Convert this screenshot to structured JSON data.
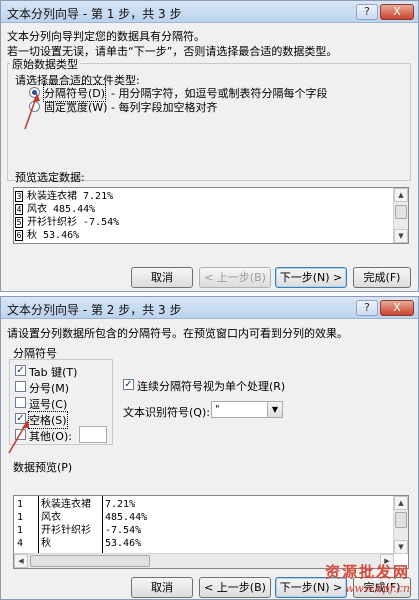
{
  "step1": {
    "title": "文本分列向导 - 第 1 步，共 3 步",
    "intro": "文本分列向导判定您的数据具有分隔符。",
    "instruction": "若一切设置无误，请单击“下一步”，否则请选择最合适的数据类型。",
    "group_label": "原始数据类型",
    "choose_label": "请选择最合适的文件类型:",
    "options": [
      {
        "label": "分隔符号(D)",
        "desc": "- 用分隔字符，如逗号或制表符分隔每个字段",
        "selected": true
      },
      {
        "label": "固定宽度(W)",
        "desc": "- 每列字段加空格对齐",
        "selected": false
      }
    ],
    "preview_label": "预览选定数据:",
    "preview_rows": [
      {
        "n": "3",
        "text": "秋装连衣裙 7.21%"
      },
      {
        "n": "4",
        "text": "风衣 485.44%"
      },
      {
        "n": "5",
        "text": "开衫针织衫 -7.54%"
      },
      {
        "n": "6",
        "text": "秋 53.46%"
      }
    ],
    "buttons": {
      "cancel": "取消",
      "back": "< 上一步(B)",
      "next": "下一步(N) >",
      "finish": "完成(F)"
    }
  },
  "step2": {
    "title": "文本分列向导 - 第 2 步，共 3 步",
    "instruction": "请设置分列数据所包含的分隔符号。在预览窗口内可看到分列的效果。",
    "delimiters_label": "分隔符号",
    "delimiters": [
      {
        "label": "Tab 键(T)",
        "checked": true
      },
      {
        "label": "分号(M)",
        "checked": false
      },
      {
        "label": "逗号(C)",
        "checked": false
      },
      {
        "label": "空格(S)",
        "checked": true
      },
      {
        "label": "其他(O):",
        "checked": false
      }
    ],
    "consecutive_label": "连续分隔符号视为单个处理(R)",
    "consecutive_checked": true,
    "qualifier_label": "文本识别符号(Q):",
    "qualifier_value": "\"",
    "preview_label": "数据预览(P)",
    "preview_rows": [
      {
        "n": "1",
        "c1": "秋装连衣裙",
        "c2": "7.21%"
      },
      {
        "n": "1",
        "c1": "风衣",
        "c2": "485.44%"
      },
      {
        "n": "1",
        "c1": "开衫针织衫",
        "c2": "-7.54%"
      },
      {
        "n": "4",
        "c1": "秋",
        "c2": "53.46%"
      }
    ],
    "buttons": {
      "cancel": "取消",
      "back": "< 上一步(B)",
      "next": "下一步(N) >",
      "finish": "完成(F)"
    }
  },
  "window_controls": {
    "help": "?",
    "close": "X"
  },
  "watermark": {
    "line1": "资源批发网",
    "line2": "www.6pf.cn"
  },
  "colors": {
    "titlebar": "#bcd3ee",
    "annotation_arrow": "#c0392b",
    "watermark": "#d64b3b"
  }
}
